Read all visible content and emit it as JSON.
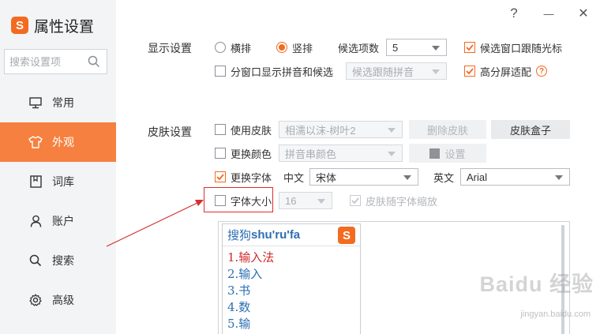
{
  "app": {
    "logo_letter": "S",
    "title": "属性设置",
    "accent_color": "#f26b21"
  },
  "window_controls": {
    "help": "?",
    "minimize": "—",
    "close": "✕"
  },
  "sidebar": {
    "search_placeholder": "搜索设置项",
    "items": [
      {
        "label": "常用",
        "icon": "monitor-icon",
        "active": false
      },
      {
        "label": "外观",
        "icon": "tshirt-icon",
        "active": true
      },
      {
        "label": "词库",
        "icon": "book-icon",
        "active": false
      },
      {
        "label": "账户",
        "icon": "person-icon",
        "active": false
      },
      {
        "label": "搜索",
        "icon": "search-icon",
        "active": false
      },
      {
        "label": "高级",
        "icon": "gear-icon",
        "active": false
      }
    ]
  },
  "display": {
    "section_label": "显示设置",
    "layout_horizontal": "横排",
    "layout_vertical": "竖排",
    "candidate_count_label": "候选项数",
    "candidate_count_value": "5",
    "follow_cursor": "候选窗口跟随光标",
    "split_window": "分窗口显示拼音和候选",
    "split_window_select": "候选跟随拼音",
    "high_dpi": "高分屏适配"
  },
  "skin": {
    "section_label": "皮肤设置",
    "use_skin": "使用皮肤",
    "skin_select": "相濡以沫-树叶2",
    "delete_skin": "删除皮肤",
    "skin_box": "皮肤盒子",
    "change_color": "更换颜色",
    "color_select": "拼音串颜色",
    "color_settings": "设置",
    "change_font": "更换字体",
    "chinese_label": "中文",
    "chinese_font": "宋体",
    "english_label": "英文",
    "english_font": "Arial",
    "font_size": "字体大小",
    "font_size_value": "16",
    "skin_scale": "皮肤随字体缩放"
  },
  "preview": {
    "pinyin_prefix": "搜狗",
    "pinyin": "shu'ru'fa",
    "candidates": [
      "1.输入法",
      "2.输入",
      "3.书",
      "4.数",
      "5.输"
    ]
  },
  "watermark": {
    "text": "Baidu 经验",
    "sub": "jingyan.baidu.com"
  }
}
